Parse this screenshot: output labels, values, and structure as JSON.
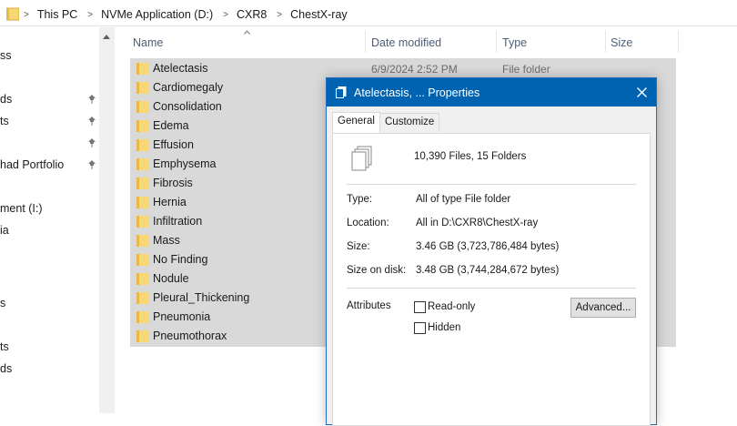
{
  "breadcrumb": {
    "items": [
      "This PC",
      "NVMe Application (D:)",
      "CXR8",
      "ChestX-ray"
    ]
  },
  "nav": {
    "items": [
      {
        "label": "ss",
        "pinned": false
      },
      {
        "label": "ds",
        "pinned": true
      },
      {
        "label": "ts",
        "pinned": true
      },
      {
        "label": "",
        "pinned": true
      },
      {
        "label": "had Portfolio",
        "pinned": true
      },
      {
        "label": "ment (I:)",
        "pinned": false
      },
      {
        "label": "ia",
        "pinned": false
      },
      {
        "label": "s",
        "pinned": false
      },
      {
        "label": "ts",
        "pinned": false
      },
      {
        "label": "ds",
        "pinned": false
      }
    ]
  },
  "columns": {
    "name": "Name",
    "date_modified": "Date modified",
    "type": "Type",
    "size": "Size"
  },
  "files": [
    {
      "name": "Atelectasis",
      "date": "6/9/2024 2:52 PM",
      "type": "File folder"
    },
    {
      "name": "Cardiomegaly",
      "date": "",
      "type": ""
    },
    {
      "name": "Consolidation",
      "date": "",
      "type": ""
    },
    {
      "name": "Edema",
      "date": "",
      "type": ""
    },
    {
      "name": "Effusion",
      "date": "",
      "type": ""
    },
    {
      "name": "Emphysema",
      "date": "",
      "type": ""
    },
    {
      "name": "Fibrosis",
      "date": "",
      "type": ""
    },
    {
      "name": "Hernia",
      "date": "",
      "type": ""
    },
    {
      "name": "Infiltration",
      "date": "",
      "type": ""
    },
    {
      "name": "Mass",
      "date": "",
      "type": ""
    },
    {
      "name": "No Finding",
      "date": "",
      "type": ""
    },
    {
      "name": "Nodule",
      "date": "",
      "type": ""
    },
    {
      "name": "Pleural_Thickening",
      "date": "",
      "type": ""
    },
    {
      "name": "Pneumonia",
      "date": "",
      "type": ""
    },
    {
      "name": "Pneumothorax",
      "date": "",
      "type": ""
    }
  ],
  "dialog": {
    "title": "Atelectasis, ... Properties",
    "tabs": [
      "General",
      "Customize"
    ],
    "active_tab": "General",
    "summary": "10,390 Files, 15 Folders",
    "type_label": "Type:",
    "type_value": "All of type File folder",
    "location_label": "Location:",
    "location_value": "All in D:\\CXR8\\ChestX-ray",
    "size_label": "Size:",
    "size_value": "3.46 GB (3,723,786,484 bytes)",
    "size_on_disk_label": "Size on disk:",
    "size_on_disk_value": "3.48 GB (3,744,284,672 bytes)",
    "attributes_label": "Attributes",
    "readonly_label": "Read-only",
    "hidden_label": "Hidden",
    "advanced_label": "Advanced..."
  },
  "colors": {
    "folder": "#f8d775",
    "folder_dark": "#e8b84a",
    "titlebar": "#0063b1",
    "selection": "#d9d9d9",
    "header_text": "#4c607a"
  }
}
